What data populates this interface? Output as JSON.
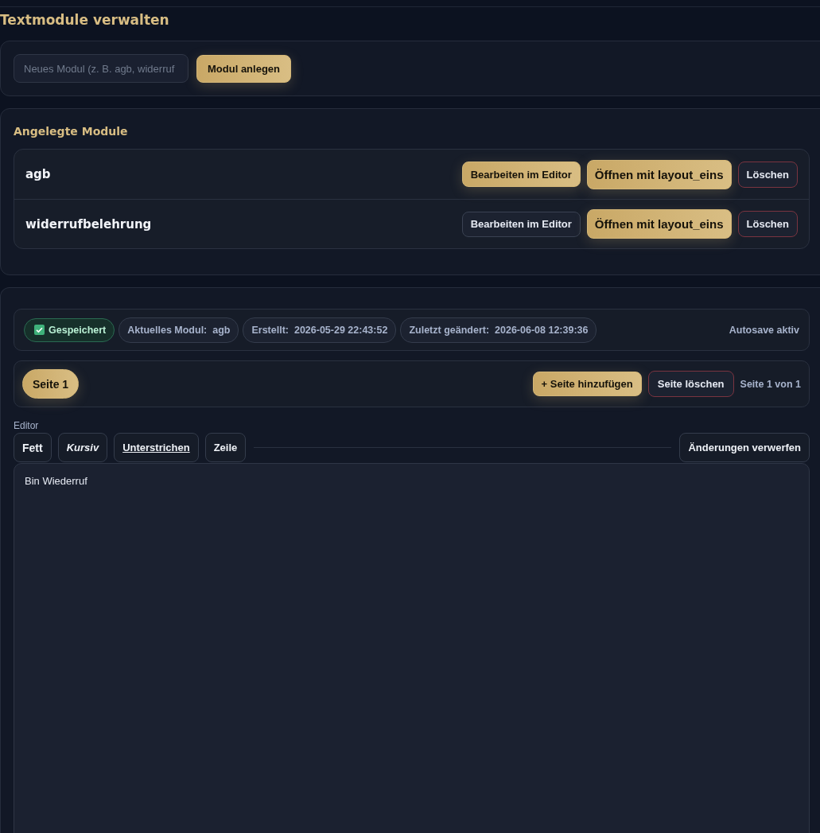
{
  "title": "Textmodule verwalten",
  "new_module": {
    "placeholder": "Neues Modul (z. B. agb, widerruf",
    "button": "Modul anlegen"
  },
  "modules": {
    "title": "Angelegte Module",
    "items": [
      {
        "name": "agb",
        "selected": true,
        "edit": "Bearbeiten im Editor",
        "open": "Öffnen mit layout_eins",
        "delete": "Löschen"
      },
      {
        "name": "widerrufbelehrung",
        "selected": false,
        "edit": "Bearbeiten im Editor",
        "open": "Öffnen mit layout_eins",
        "delete": "Löschen"
      }
    ]
  },
  "status": {
    "saved": {
      "label": "Gespeichert",
      "checked": true
    },
    "chips": [
      {
        "label": "Aktuelles Modul:",
        "value": "agb"
      },
      {
        "label": "Erstellt:",
        "value": "2026-05-29 22:43:52"
      },
      {
        "label": "Zuletzt geändert:",
        "value": "2026-06-08 12:39:36"
      }
    ],
    "autosave": "Autosave aktiv"
  },
  "pages": {
    "tabs": [
      {
        "label": "Seite 1",
        "selected": true
      }
    ],
    "add": "+ Seite hinzufügen",
    "delete": "Seite löschen",
    "counter": "Seite 1 von 1"
  },
  "editor": {
    "label": "Editor",
    "tools": [
      {
        "label": "Fett",
        "kind": "bold"
      },
      {
        "label": "Kursiv",
        "kind": "italic"
      },
      {
        "label": "Unterstrichen",
        "kind": "underline"
      },
      {
        "label": "Zeile",
        "kind": "line"
      }
    ],
    "discard": "Änderungen verwerfen",
    "content": "Bin Wiederruf"
  }
}
